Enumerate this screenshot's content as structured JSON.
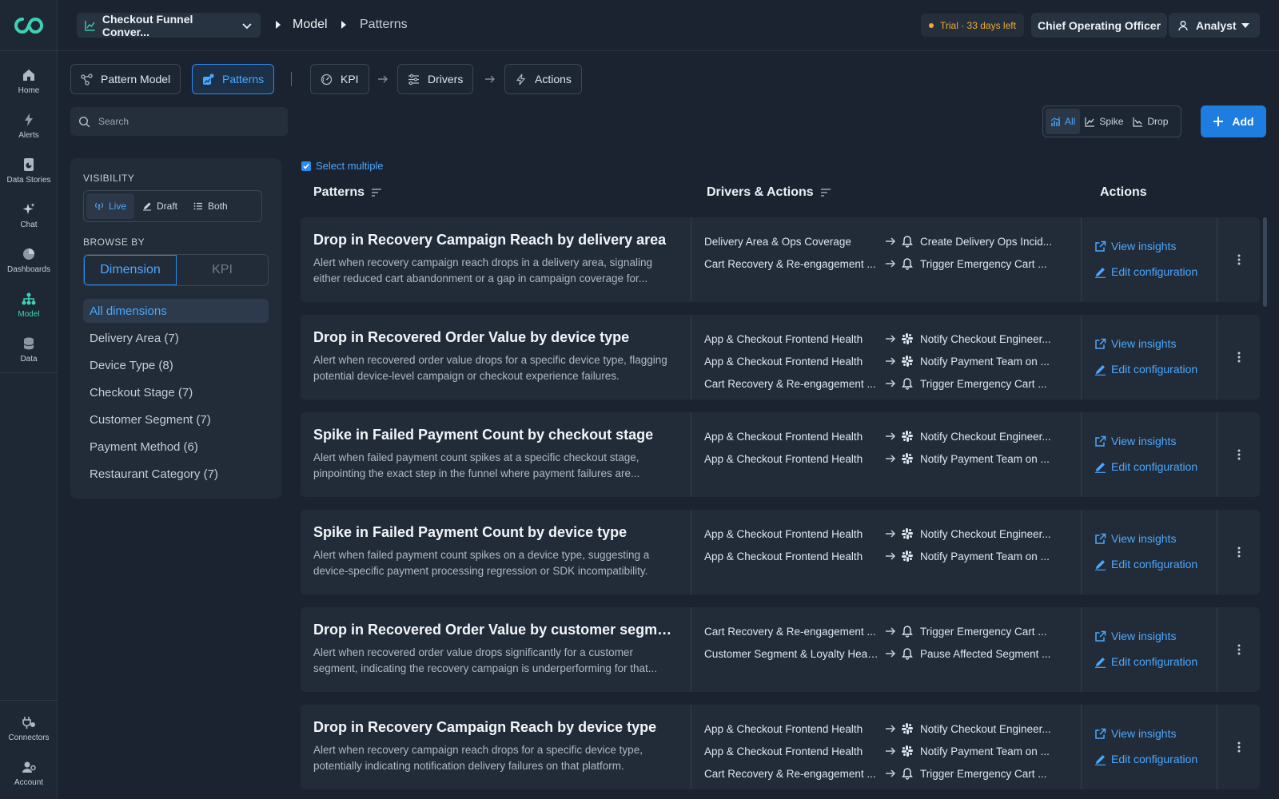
{
  "colors": {
    "accent": "#2b8cf0",
    "brand": "#3ed1b6",
    "warning": "#f0a936",
    "bg": "#1b2330"
  },
  "nav": {
    "items": [
      {
        "label": "Home",
        "icon": "home-icon"
      },
      {
        "label": "Alerts",
        "icon": "lightning-icon"
      },
      {
        "label": "Data Stories",
        "icon": "data-stories-icon"
      },
      {
        "label": "Chat",
        "icon": "sparkle-icon"
      },
      {
        "label": "Dashboards",
        "icon": "pie-chart-icon"
      },
      {
        "label": "Model",
        "icon": "hierarchy-icon",
        "active": true
      },
      {
        "label": "Data",
        "icon": "database-icon"
      }
    ],
    "bottom": [
      {
        "label": "Connectors",
        "icon": "plug-icon"
      },
      {
        "label": "Account",
        "icon": "account-settings-icon"
      }
    ]
  },
  "header": {
    "project": "Checkout Funnel Conver...",
    "crumb1": "Model",
    "crumb2": "Patterns",
    "trial": "Trial · 33 days left",
    "role": "Chief Operating Officer",
    "user": "Analyst"
  },
  "tabs": {
    "pattern_model": "Pattern Model",
    "patterns": "Patterns",
    "kpi": "KPI",
    "drivers": "Drivers",
    "actions": "Actions"
  },
  "search": {
    "placeholder": "Search"
  },
  "type_filter": {
    "all": "All",
    "spike": "Spike",
    "drop": "Drop"
  },
  "add_label": "Add",
  "filters": {
    "visibility_label": "VISIBILITY",
    "visibility": {
      "live": "Live",
      "draft": "Draft",
      "both": "Both"
    },
    "browse_label": "BROWSE BY",
    "browse": {
      "dimension": "Dimension",
      "kpi": "KPI"
    },
    "dimensions": [
      "All dimensions",
      "Delivery Area (7)",
      "Device Type (8)",
      "Checkout Stage (7)",
      "Customer Segment (7)",
      "Payment Method (6)",
      "Restaurant Category (7)"
    ]
  },
  "table": {
    "select_multiple": "Select multiple",
    "col_patterns": "Patterns",
    "col_drivers": "Drivers & Actions",
    "col_actions": "Actions",
    "view_insights": "View insights",
    "edit_configuration": "Edit configuration",
    "rows": [
      {
        "title": "Drop in Recovery Campaign Reach by delivery area",
        "desc": "Alert when recovery campaign reach drops in a delivery area, signaling either reduced cart abandonment or a gap in campaign coverage for...",
        "links": [
          {
            "driver": "Delivery Area & Ops Coverage",
            "icon": "bell",
            "action": "Create Delivery Ops Incid..."
          },
          {
            "driver": "Cart Recovery & Re-engagement ...",
            "icon": "bell",
            "action": "Trigger Emergency Cart ..."
          }
        ]
      },
      {
        "title": "Drop in Recovered Order Value by device type",
        "desc": "Alert when recovered order value drops for a specific device type, flagging potential device-level campaign or checkout experience failures.",
        "links": [
          {
            "driver": "App & Checkout Frontend Health",
            "icon": "slack",
            "action": "Notify Checkout Engineer..."
          },
          {
            "driver": "App & Checkout Frontend Health",
            "icon": "slack",
            "action": "Notify Payment Team on ..."
          },
          {
            "driver": "Cart Recovery & Re-engagement ...",
            "icon": "bell",
            "action": "Trigger Emergency Cart ..."
          }
        ]
      },
      {
        "title": "Spike in Failed Payment Count by checkout stage",
        "desc": "Alert when failed payment count spikes at a specific checkout stage, pinpointing the exact step in the funnel where payment failures are...",
        "links": [
          {
            "driver": "App & Checkout Frontend Health",
            "icon": "slack",
            "action": "Notify Checkout Engineer..."
          },
          {
            "driver": "App & Checkout Frontend Health",
            "icon": "slack",
            "action": "Notify Payment Team on ..."
          }
        ]
      },
      {
        "title": "Spike in Failed Payment Count by device type",
        "desc": "Alert when failed payment count spikes on a device type, suggesting a device-specific payment processing regression or SDK incompatibility.",
        "links": [
          {
            "driver": "App & Checkout Frontend Health",
            "icon": "slack",
            "action": "Notify Checkout Engineer..."
          },
          {
            "driver": "App & Checkout Frontend Health",
            "icon": "slack",
            "action": "Notify Payment Team on ..."
          }
        ]
      },
      {
        "title": "Drop in Recovered Order Value by customer segment",
        "desc": "Alert when recovered order value drops significantly for a customer segment, indicating the recovery campaign is underperforming for that...",
        "links": [
          {
            "driver": "Cart Recovery & Re-engagement ...",
            "icon": "bell",
            "action": "Trigger Emergency Cart ..."
          },
          {
            "driver": "Customer Segment & Loyalty Heal...",
            "icon": "bell",
            "action": "Pause Affected Segment ..."
          }
        ]
      },
      {
        "title": "Drop in Recovery Campaign Reach by device type",
        "desc": "Alert when recovery campaign reach drops for a specific device type, potentially indicating notification delivery failures on that platform.",
        "links": [
          {
            "driver": "App & Checkout Frontend Health",
            "icon": "slack",
            "action": "Notify Checkout Engineer..."
          },
          {
            "driver": "App & Checkout Frontend Health",
            "icon": "slack",
            "action": "Notify Payment Team on ..."
          },
          {
            "driver": "Cart Recovery & Re-engagement ...",
            "icon": "bell",
            "action": "Trigger Emergency Cart ..."
          }
        ]
      }
    ]
  }
}
